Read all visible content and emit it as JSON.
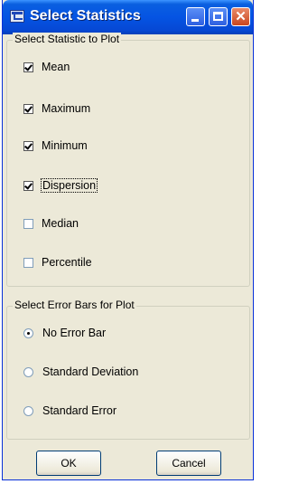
{
  "window": {
    "title": "Select Statistics"
  },
  "stats_group": {
    "legend": "Select Statistic to Plot",
    "options": [
      {
        "label": "Mean",
        "checked": true
      },
      {
        "label": "Maximum",
        "checked": true
      },
      {
        "label": "Minimum",
        "checked": true
      },
      {
        "label": "Dispersion",
        "checked": true
      },
      {
        "label": "Median",
        "checked": false
      },
      {
        "label": "Percentile",
        "checked": false
      }
    ]
  },
  "errorbar_group": {
    "legend": "Select Error Bars for Plot",
    "options": [
      {
        "label": "No Error Bar",
        "selected": true
      },
      {
        "label": "Standard Deviation",
        "selected": false
      },
      {
        "label": "Standard Error",
        "selected": false
      }
    ]
  },
  "buttons": {
    "ok": "OK",
    "cancel": "Cancel"
  },
  "colors": {
    "titlebar": "#0554e3",
    "window_bg": "#ece9d8",
    "close_button": "#c9461f"
  }
}
